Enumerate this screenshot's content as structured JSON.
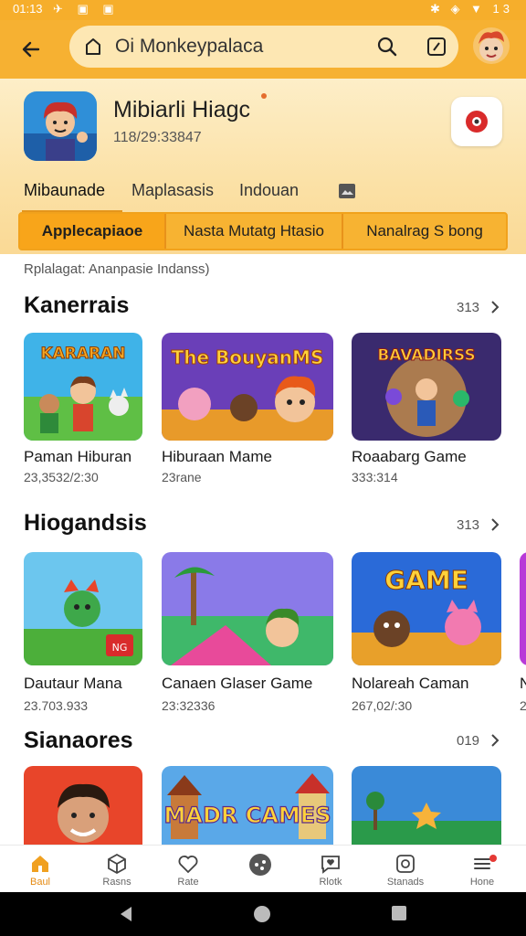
{
  "status_bar": {
    "time": "01:13",
    "right_text": "13"
  },
  "top_bar": {
    "search_value": "Oi Monkeypalaca"
  },
  "app": {
    "name": "Mibiarli Hiagc",
    "subtitle": "118/29:33847"
  },
  "tabs": [
    {
      "label": "Mibaunade",
      "active": true
    },
    {
      "label": "Maplasasis",
      "active": false
    },
    {
      "label": "Indouan",
      "active": false
    }
  ],
  "segments": [
    {
      "label": "Applecapiaoe",
      "active": true
    },
    {
      "label": "Nasta Mutatg Htasio",
      "active": false
    },
    {
      "label": "Nanalrag S bong",
      "active": false
    }
  ],
  "subtitle": "Rplalagat: Ananpasie Indanss)",
  "sections": [
    {
      "title": "Kanerrais",
      "count": "313",
      "cards": [
        {
          "title": "Paman Hiburan",
          "meta": "23,3532/2:30",
          "art_text": "KARARAN"
        },
        {
          "title": "Hiburaan Mame",
          "meta": "23rane",
          "art_text": "The BouyanMS"
        },
        {
          "title": "Roaabarg Game",
          "meta": "333:314",
          "art_text": "BAVADIRSS"
        }
      ]
    },
    {
      "title": "Hiogandsis",
      "count": "313",
      "cards": [
        {
          "title": "Dautaur Mana",
          "meta": "23.703.933",
          "art_text": "NG"
        },
        {
          "title": "Canaen Glaser Game",
          "meta": "23:32336",
          "art_text": ""
        },
        {
          "title": "Nolareah Caman",
          "meta": "267,02/:30",
          "art_text": "GAME"
        },
        {
          "title": "N",
          "meta": "2"
        }
      ]
    },
    {
      "title": "Sianaores",
      "count": "019",
      "cards": [
        {
          "title": "",
          "meta": "",
          "art_text": ""
        },
        {
          "title": "",
          "meta": "",
          "art_text": "MADR CAMES"
        },
        {
          "title": "",
          "meta": "",
          "art_text": ""
        }
      ]
    }
  ],
  "bottom_nav": [
    {
      "label": "Baul",
      "icon": "home-icon",
      "active": true
    },
    {
      "label": "Rasns",
      "icon": "cube-icon",
      "active": false
    },
    {
      "label": "Rate",
      "icon": "heart-icon",
      "active": false
    },
    {
      "label": "",
      "icon": "game-icon",
      "active": false
    },
    {
      "label": "Rlotk",
      "icon": "heart-chat-icon",
      "active": false
    },
    {
      "label": "Stanads",
      "icon": "camera-icon",
      "active": false
    },
    {
      "label": "Hone",
      "icon": "menu-icon",
      "active": false
    }
  ],
  "colors": {
    "brand": "#f6b132",
    "accent": "#e5951a"
  }
}
